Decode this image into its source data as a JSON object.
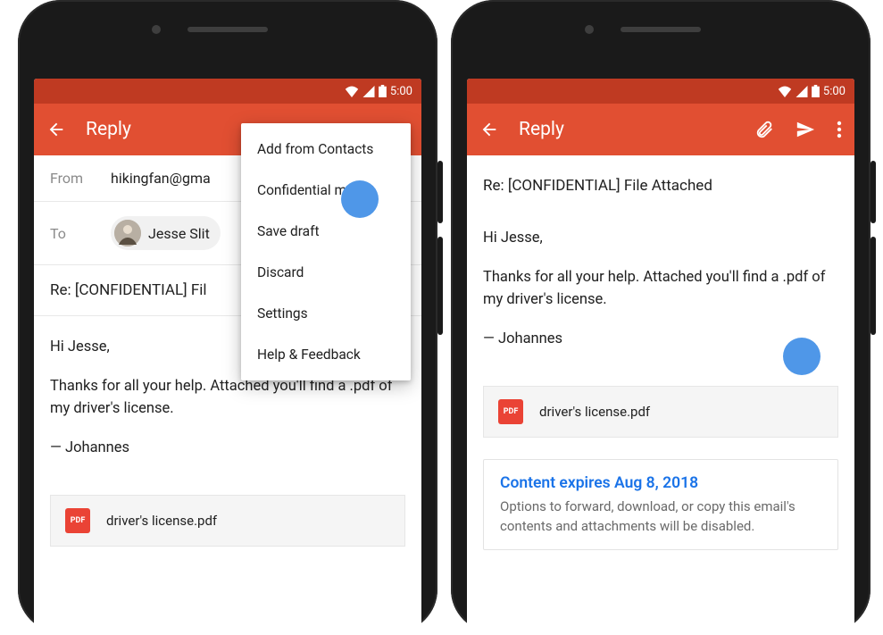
{
  "status": {
    "time": "5:00"
  },
  "appbar": {
    "title": "Reply"
  },
  "left": {
    "from_label": "From",
    "from_value": "hikingfan@gma",
    "to_label": "To",
    "to_chip": "Jesse Slit",
    "subject": "Re: [CONFIDENTIAL] Fil",
    "body_greeting": "Hi Jesse,",
    "body_para": "Thanks for all your help. Attached you'll find a .pdf of my driver's license.",
    "body_sign": "— Johannes",
    "attachment": "driver's license.pdf",
    "pdf_badge": "PDF",
    "menu": {
      "add_contacts": "Add from Contacts",
      "confidential": "Confidential mode",
      "save_draft": "Save draft",
      "discard": "Discard",
      "settings": "Settings",
      "help": "Help & Feedback"
    }
  },
  "right": {
    "subject": "Re: [CONFIDENTIAL] File Attached",
    "body_greeting": "Hi Jesse,",
    "body_para": "Thanks for all your help. Attached you'll find a .pdf of my driver's license.",
    "body_sign": "— Johannes",
    "attachment": "driver's license.pdf",
    "pdf_badge": "PDF",
    "conf_title": "Content expires Aug 8, 2018",
    "conf_body": "Options to forward, download, or copy this email's contents and attachments will be disabled."
  }
}
